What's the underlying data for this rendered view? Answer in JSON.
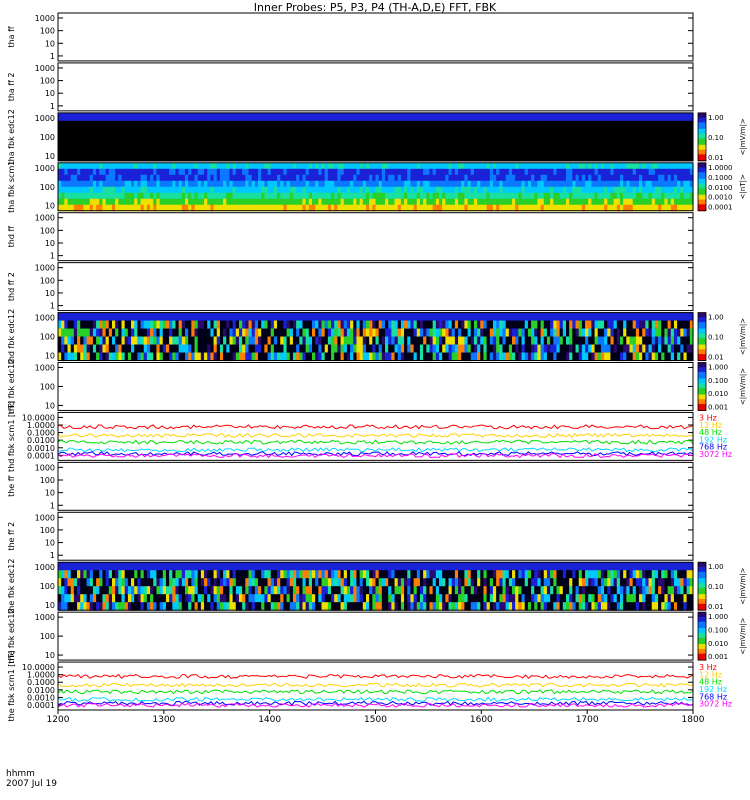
{
  "title": "Inner Probes: P5, P3, P4 (TH-A,D,E) FFT, FBK",
  "colors": {
    "black": "#000000",
    "spectrum": [
      "#2a0a6e",
      "#1a22d8",
      "#0a78ff",
      "#00c8ff",
      "#18e0a0",
      "#28d028",
      "#f0e000",
      "#ff8000",
      "#e80000"
    ],
    "lines": {
      "3 Hz": "#ff0000",
      "12 Hz": "#ffd000",
      "48 Hz": "#00e000",
      "192 Hz": "#00d8ff",
      "768 Hz": "#0000ff",
      "3072 Hz": "#ff00ff"
    }
  },
  "footer": {
    "time_label": "hhmm",
    "date_label": "2007 Jul 19"
  },
  "chart_data": {
    "type": "heatmap",
    "x_axis": {
      "range": [
        1200,
        1800
      ],
      "ticks": [
        "1200",
        "1300",
        "1400",
        "1500",
        "1600",
        "1700",
        "1800"
      ]
    },
    "panels": [
      {
        "id": "tha-ff",
        "ylabel": [
          "tha",
          "ff"
        ],
        "kind": "empty",
        "ytick_labels": [
          "1000",
          "100",
          "10",
          "1"
        ]
      },
      {
        "id": "tha-ff2",
        "ylabel": [
          "tha",
          "ff",
          "2"
        ],
        "kind": "empty",
        "ytick_labels": [
          "1000",
          "100",
          "10",
          "1"
        ]
      },
      {
        "id": "tha-fbk-edc12",
        "ylabel": [
          "tha",
          "fbk",
          "edc12"
        ],
        "kind": "spec",
        "pattern": "top-band",
        "ytick_labels": [
          "1000",
          "100",
          "10"
        ],
        "colorbar": {
          "ticks": [
            "1.00",
            "0.10",
            "0.01"
          ],
          "unit": "<|mV/m|>"
        }
      },
      {
        "id": "tha-fbk-scm1",
        "ylabel": [
          "tha",
          "fbk",
          "scm1"
        ],
        "kind": "spec",
        "pattern": "scm",
        "ytick_labels": [
          "1000",
          "100",
          "10"
        ],
        "colorbar": {
          "ticks": [
            "1.0000",
            "0.1000",
            "0.0100",
            "0.0010",
            "0.0001"
          ],
          "unit": "<|nT|>"
        }
      },
      {
        "id": "thd-ff",
        "ylabel": [
          "thd",
          "ff"
        ],
        "kind": "empty",
        "ytick_labels": [
          "1000",
          "100",
          "10",
          "1"
        ]
      },
      {
        "id": "thd-ff2",
        "ylabel": [
          "thd",
          "ff",
          "2"
        ],
        "kind": "empty",
        "ytick_labels": [
          "1000",
          "100",
          "10",
          "1"
        ]
      },
      {
        "id": "thd-fbk-edc12",
        "ylabel": [
          "thd",
          "fbk",
          "edc12"
        ],
        "kind": "spec",
        "pattern": "noisy",
        "ytick_labels": [
          "1000",
          "100",
          "10"
        ],
        "colorbar": {
          "ticks": [
            "1.00",
            "0.10",
            "0.01"
          ],
          "unit": "<|mV/m|>"
        }
      },
      {
        "id": "thd-fbk-edc12-b",
        "ylabel": [
          "thd",
          "fbk",
          "edc12"
        ],
        "kind": "empty",
        "ytick_labels": [
          "1000",
          "100",
          "10"
        ],
        "colorbar": {
          "ticks": [
            "1.000",
            "0.100",
            "0.010",
            "0.001"
          ],
          "unit": "<|mV/m|>"
        }
      },
      {
        "id": "thd-scm",
        "ylabel": [
          "thd",
          "fbk",
          "scm1"
        ],
        "units": "[nT]",
        "kind": "lines",
        "ytick_labels": [
          "10.0000",
          "1.0000",
          "0.1000",
          "0.0100",
          "0.0010",
          "0.0001"
        ],
        "legend": [
          "3 Hz",
          "12 Hz",
          "48 Hz",
          "192 Hz",
          "768 Hz",
          "3072 Hz"
        ]
      },
      {
        "id": "the-ff",
        "ylabel": [
          "the",
          "ff"
        ],
        "kind": "empty",
        "ytick_labels": [
          "1000",
          "100",
          "10",
          "1"
        ]
      },
      {
        "id": "the-ff2",
        "ylabel": [
          "the",
          "ff",
          "2"
        ],
        "kind": "empty",
        "ytick_labels": [
          "1000",
          "100",
          "10",
          "1"
        ]
      },
      {
        "id": "the-fbk-edc12",
        "ylabel": [
          "the",
          "fbk",
          "edc12"
        ],
        "kind": "spec",
        "pattern": "noisy2",
        "ytick_labels": [
          "1000",
          "100",
          "10"
        ],
        "colorbar": {
          "ticks": [
            "1.00",
            "0.10",
            "0.01"
          ],
          "unit": "<|mV/m|>"
        }
      },
      {
        "id": "the-fbk-edc12-b",
        "ylabel": [
          "the",
          "fbk",
          "edc12"
        ],
        "kind": "empty",
        "ytick_labels": [
          "1000",
          "100",
          "10"
        ],
        "colorbar": {
          "ticks": [
            "1.000",
            "0.100",
            "0.010",
            "0.001"
          ],
          "unit": "<|mV/m|>"
        }
      },
      {
        "id": "the-scm",
        "ylabel": [
          "the",
          "fbk",
          "scm1"
        ],
        "units": "[nT]",
        "kind": "lines",
        "ytick_labels": [
          "10.0000",
          "1.0000",
          "0.1000",
          "0.0100",
          "0.0010",
          "0.0001"
        ],
        "legend": [
          "3 Hz",
          "12 Hz",
          "48 Hz",
          "192 Hz",
          "768 Hz",
          "3072 Hz"
        ]
      }
    ]
  }
}
